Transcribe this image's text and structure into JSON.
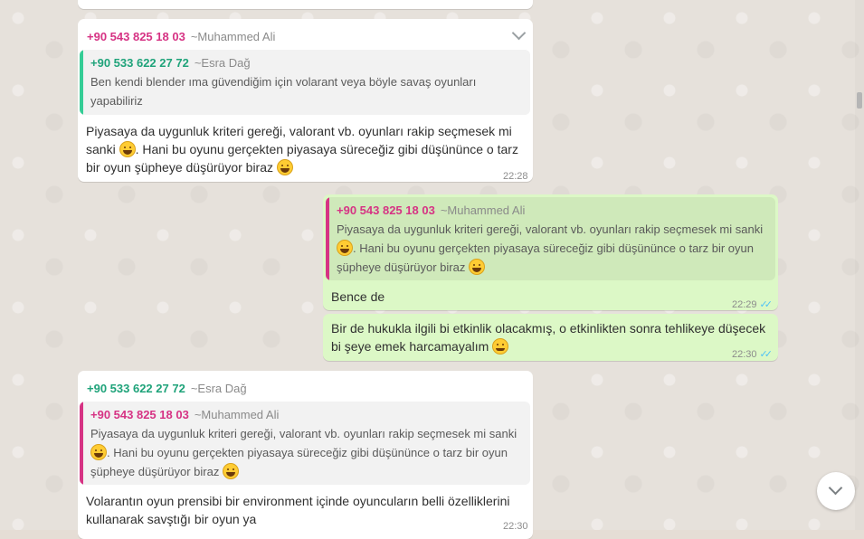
{
  "messages": [
    {
      "sender_phone": "+90 543 825 18 03",
      "sender_name": "~Muhammed Ali",
      "quote_phone": "+90 533 622 27 72",
      "quote_name": "~Esra Dağ",
      "quote_line1": "Ben kendi blender ıma güvendiğim için volarant veya böyle savaş oyunları",
      "quote_line2": "yapabiliriz",
      "line1": "Piyasaya da uygunluk kriteri gereği, valorant vb. oyunları rakip seçmesek mi",
      "line2_a": "sanki",
      "line2_b": ". Hani bu oyunu gerçekten piyasaya süreceğiz gibi düşününce o tarz",
      "line3": "bir oyun şüpheye düşürüyor biraz",
      "time": "22:28"
    },
    {
      "quote_phone": "+90 543 825 18 03",
      "quote_name": "~Muhammed Ali",
      "quote_line1": "Piyasaya da uygunluk kriteri gereği, valorant vb. oyunları rakip seçmesek mi sanki",
      "quote_line2": ". Hani bu oyunu gerçekten piyasaya süreceğiz gibi düşününce o tarz bir oyun",
      "quote_line3": "şüpheye düşürüyor biraz",
      "text": "Bence de",
      "time": "22:29"
    },
    {
      "line1": "Bir de hukukla ilgili bi etkinlik olacakmış, o etkinlikten sonra tehlikeye düşecek",
      "line2": "bi şeye emek harcamayalım",
      "time": "22:30"
    },
    {
      "sender_phone": "+90 533 622 27 72",
      "sender_name": "~Esra Dağ",
      "quote_phone": "+90 543 825 18 03",
      "quote_name": "~Muhammed Ali",
      "quote_line1": "Piyasaya da uygunluk kriteri gereği, valorant vb. oyunları rakip seçmesek mi sanki",
      "quote_line2": ". Hani bu oyunu gerçekten piyasaya süreceğiz gibi düşününce o tarz bir oyun",
      "quote_line3": "şüpheye düşürüyor biraz",
      "line1": "Volarantın oyun prensibi bir environment içinde oyuncuların belli özelliklerini",
      "line2": "kullanarak savştığı bir oyun ya",
      "time": "22:30"
    }
  ],
  "icons": {
    "menu": "chevron-down-icon",
    "read_receipt": "double-check-icon",
    "emoji": "grinning-face-icon",
    "emoji_smile": "smiling-face-icon",
    "scroll_down": "chevron-down-icon"
  },
  "colors": {
    "incoming_bubble": "#ffffff",
    "outgoing_bubble": "#dcf8c6",
    "pink_name": "#d63384",
    "green_name": "#1fa37a",
    "read_ticks": "#4fc3f7"
  }
}
